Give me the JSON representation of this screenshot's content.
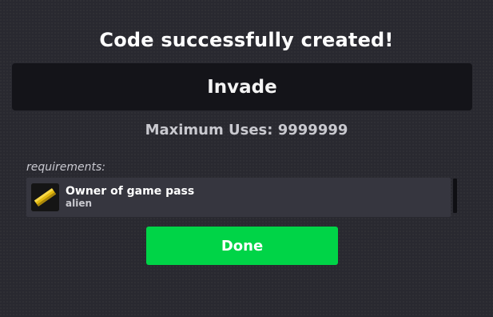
{
  "dialog": {
    "title": "Code successfully created!",
    "code": "Invade",
    "max_uses_text": "Maximum Uses: 9999999",
    "requirements_label": "requirements:",
    "requirement": {
      "title": "Owner of game pass",
      "subtitle": "alien",
      "icon": "gold-bar-icon"
    },
    "done_label": "Done"
  },
  "colors": {
    "background": "#292930",
    "code_box": "#141419",
    "panel": "#36363f",
    "done_button": "#00d447"
  }
}
